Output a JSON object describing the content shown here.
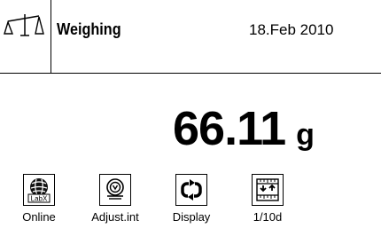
{
  "header": {
    "title": "Weighing",
    "date": "18.Feb 2010",
    "app_icon": "balance-scale-icon"
  },
  "readout": {
    "value": "66.11",
    "unit": "g"
  },
  "softkeys": [
    {
      "label": "Online",
      "icon": "labx-globe-icon",
      "badge": "LabX"
    },
    {
      "label": "Adjust.int",
      "icon": "internal-adjust-weight-icon"
    },
    {
      "label": "Display",
      "icon": "refresh-arrows-icon"
    },
    {
      "label": "1/10d",
      "icon": "resolution-scale-icon"
    }
  ],
  "colors": {
    "background": "#ffffff",
    "foreground": "#000000"
  }
}
